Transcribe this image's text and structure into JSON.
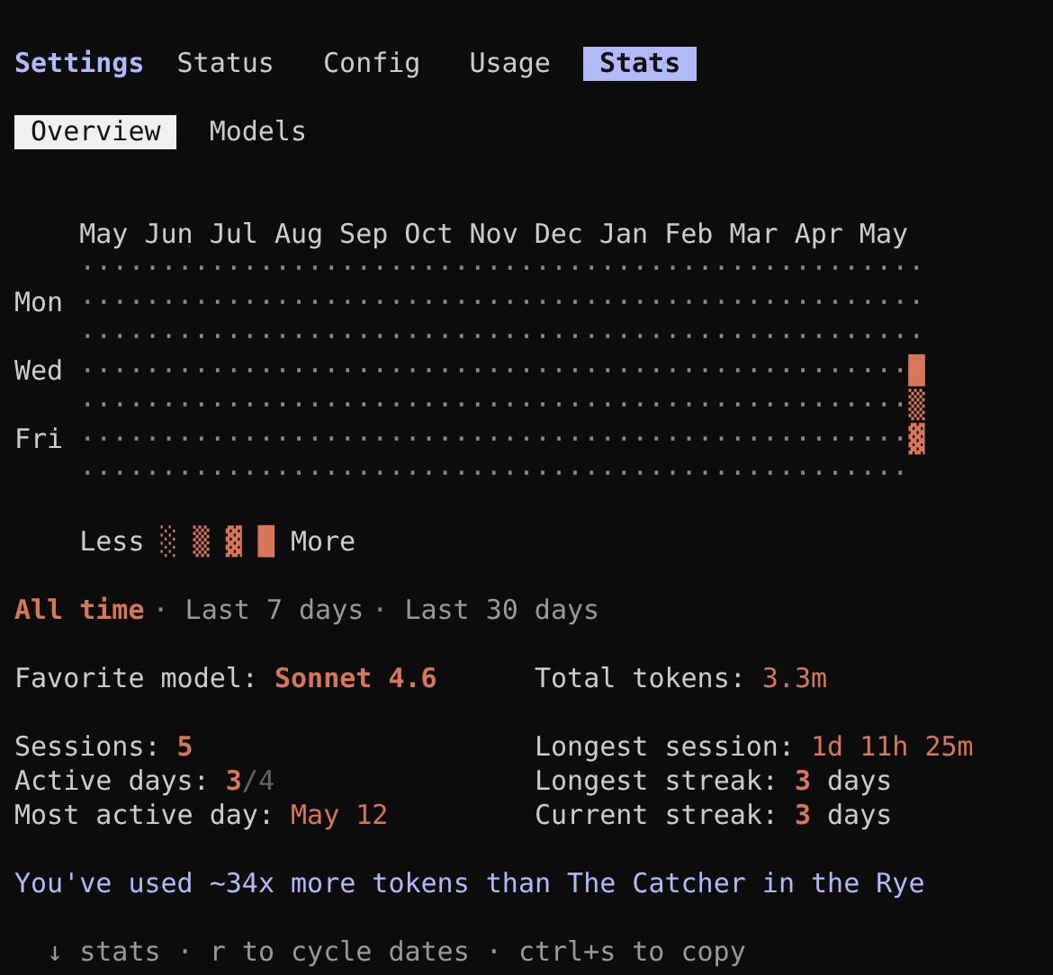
{
  "title": "Settings",
  "tabs": [
    {
      "label": "Status",
      "selected": false
    },
    {
      "label": "Config",
      "selected": false
    },
    {
      "label": "Usage",
      "selected": false
    },
    {
      "label": "Stats",
      "selected": true
    }
  ],
  "subtabs": [
    {
      "label": "Overview",
      "selected": true
    },
    {
      "label": "Models",
      "selected": false
    }
  ],
  "heatmap": {
    "months": [
      "May",
      "Jun",
      "Jul",
      "Aug",
      "Sep",
      "Oct",
      "Nov",
      "Dec",
      "Jan",
      "Feb",
      "Mar",
      "Apr",
      "May"
    ],
    "rows": [
      {
        "dots": "····················································"
      },
      {
        "label": "Mon",
        "dots": "····················································"
      },
      {
        "dots": "····················································"
      },
      {
        "label": "Wed",
        "dots": "···················································",
        "active": "█"
      },
      {
        "dots": "···················································",
        "active": "▒"
      },
      {
        "label": "Fri",
        "dots": "···················································",
        "active": "▓"
      },
      {
        "dots": "···················································"
      }
    ],
    "legend": {
      "less": "Less",
      "glyphs": [
        "░",
        "▒",
        "▓",
        "█"
      ],
      "more": "More"
    }
  },
  "range": {
    "separator": "·",
    "options": [
      {
        "label": "All time",
        "selected": true
      },
      {
        "label": "Last 7 days",
        "selected": false
      },
      {
        "label": "Last 30 days",
        "selected": false
      }
    ]
  },
  "stats": [
    [
      [
        {
          "label": "Favorite model:",
          "value": "Sonnet 4.6",
          "bold": true
        },
        {
          "label": "Total tokens:",
          "value": "3.3m",
          "bold": false
        }
      ]
    ],
    [
      [
        {
          "label": "Sessions:",
          "value": "5",
          "bold": true
        },
        {
          "label": "Longest session:",
          "value": "1d 11h 25m",
          "bold": false
        }
      ],
      [
        {
          "label": "Active days:",
          "value": "3",
          "total": "/4",
          "bold": true
        },
        {
          "label": "Longest streak:",
          "value": "3",
          "unit": "days",
          "bold": true
        }
      ],
      [
        {
          "label": "Most active day:",
          "value": "May 12",
          "bold": false
        },
        {
          "label": "Current streak:",
          "value": "3",
          "unit": "days",
          "bold": true
        }
      ]
    ]
  ],
  "message": "You've used ~34x more tokens than The Catcher in the Rye",
  "footer": "↓ stats · r to cycle dates · ctrl+s to copy"
}
